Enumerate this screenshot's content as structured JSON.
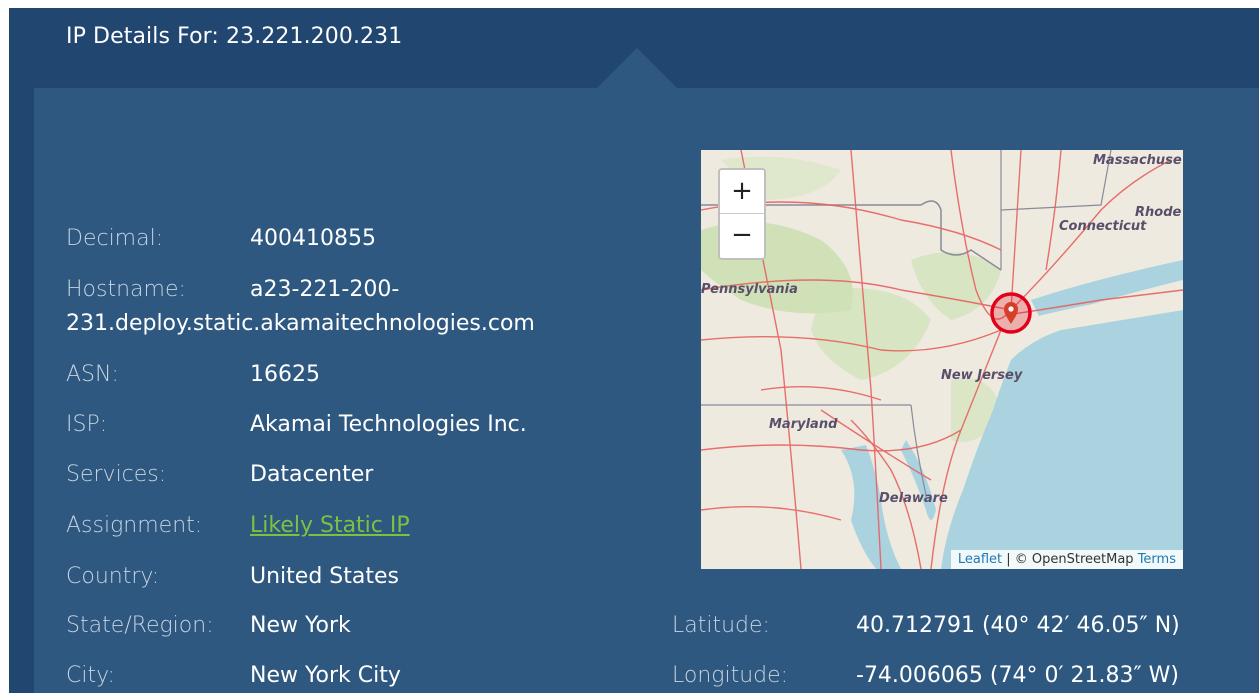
{
  "header": {
    "title": "IP Details For: 23.221.200.231"
  },
  "details": [
    {
      "label": "Decimal:",
      "value": "400410855"
    },
    {
      "label": "Hostname:",
      "value_line1": "a23-221-200-",
      "value_line2": "231.deploy.static.akamaitechnologies.com"
    },
    {
      "label": "ASN:",
      "value": "16625"
    },
    {
      "label": "ISP:",
      "value": "Akamai Technologies Inc."
    },
    {
      "label": "Services:",
      "value": "Datacenter"
    },
    {
      "label": "Assignment:",
      "value": "Likely Static IP"
    },
    {
      "label": "Country:",
      "value": "United States"
    },
    {
      "label": "State/Region:",
      "value": "New York"
    },
    {
      "label": "City:",
      "value": "New York City"
    }
  ],
  "coords": {
    "latitude_label": "Latitude:",
    "latitude_value": "40.712791  (40° 42′ 46.05″ N)",
    "longitude_label": "Longitude:",
    "longitude_value": "-74.006065  (74° 0′ 21.83″ W)"
  },
  "map": {
    "zoom_in": "+",
    "zoom_out": "−",
    "labels": {
      "massachusetts": "Massachuse",
      "rhode": "Rhode",
      "connecticut": "Connecticut",
      "pennsylvania": "Pennsylvania",
      "new_jersey": "New Jersey",
      "maryland": "Maryland",
      "delaware": "Delaware"
    },
    "attribution": {
      "leaflet": "Leaflet",
      "separator": " | © OpenStreetMap ",
      "terms": "Terms"
    },
    "colors": {
      "water": "#aad3df",
      "land": "#eeeadf",
      "forest": "#c8dfae",
      "road": "#e8605f",
      "marker": "#d63e2a",
      "highlight_ring": "#e3001b"
    }
  }
}
